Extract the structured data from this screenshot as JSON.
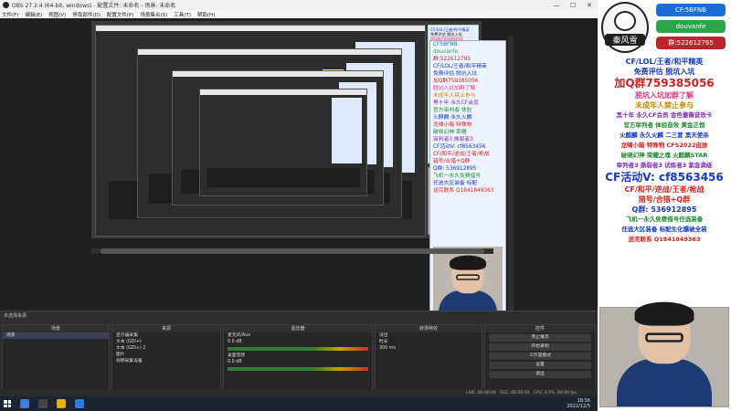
{
  "window": {
    "title": "OBS 27.2.4 (64-bit, windows) - 配置文件: 未命名 - 场景: 未命名",
    "controls": [
      "—",
      "☐",
      "✕"
    ]
  },
  "menu": [
    "文件(F)",
    "编辑(E)",
    "视图(V)",
    "停靠部件(D)",
    "配置文件(P)",
    "场景集合(S)",
    "工具(T)",
    "帮助(H)"
  ],
  "docks": {
    "scenes_header": "场景",
    "scenes": [
      "场景"
    ],
    "sources_header": "来源",
    "sources": [
      "显示器采集",
      "文本 (GDI+)",
      "文本 (GDI+) 2",
      "图片",
      "视频采集设备"
    ],
    "mixer_header": "混音器",
    "mixer": [
      "麦克风/Aux",
      "桌面音频"
    ],
    "mixer_db": [
      "0.0 dB",
      "0.0 dB"
    ],
    "transitions_header": "转场特效",
    "transition_value": "淡出",
    "duration_label": "时长",
    "duration_value": "300 ms",
    "controls_header": "控件",
    "controls": [
      "停止推流",
      "开始录制",
      "工作室模式",
      "设置",
      "退出"
    ],
    "filter_label": "未选择来源"
  },
  "status": {
    "live": "LIVE: 00:00:00",
    "rec": "REC: 00:00:00",
    "cpu": "CPU: 4.0%, 60.00 fps"
  },
  "taskbar": {
    "time": "18:56",
    "date": "2022/12/5"
  },
  "overlay": {
    "logo_text": "秦风雪",
    "pills": [
      "CF:5BFNB",
      "douvanfe",
      "群:522612795"
    ],
    "lines": [
      {
        "t": "CF/LOL/王者/和平精英",
        "c": "blue"
      },
      {
        "t": "免费评估 脱坑入坑",
        "c": "blue"
      },
      {
        "t": "加Q群759385056",
        "c": "red",
        "big": true
      },
      {
        "t": "脱坑入坑加群了解",
        "c": "pink"
      },
      {
        "t": "未成年人禁止参与",
        "c": "gold"
      },
      {
        "t": "黑十年 永久CF会员 金色蔷薇音效卡",
        "c": "purple"
      },
      {
        "t": "官方审判者 体验音效 黄金正恒",
        "c": "green"
      },
      {
        "t": "火麒麟 永久火麟 二三套 黑天使杀",
        "c": "blue"
      },
      {
        "t": "龙啸小箱 特殊物 CFS2022皮肤",
        "c": "red"
      },
      {
        "t": "破晓幻神 荣耀之魂 火麒麟STAR",
        "c": "green"
      },
      {
        "t": "审判者3 撕裂者3 试炼者3 紫金满级",
        "c": "purple"
      },
      {
        "t": "CF活动V: cf8563456",
        "c": "blue",
        "big": true
      },
      {
        "t": "CF/和平/逆战/王者/枪战",
        "c": "red"
      },
      {
        "t": "猎号/合猎+Q群",
        "c": "red"
      },
      {
        "t": "Q群: 536912895",
        "c": "blue"
      },
      {
        "t": "飞机一永久免费借号任选装备",
        "c": "green"
      },
      {
        "t": "任选大区装备 标配生化爆破全装",
        "c": "blue"
      },
      {
        "t": "送完联系 Q1841849363",
        "c": "red"
      }
    ]
  },
  "canvas_poster": [
    "CF/LOL/王者/和平精英",
    "免费评估 脱坑入坑",
    "加Q群759385056",
    "脱坑入坑加群了解",
    "未成年人禁止参与",
    "黑十年 永久CF会员",
    "官方审判者 体验",
    "火麒麟 永久火麟",
    "龙啸小箱 特殊物",
    "破晓幻神 荣耀",
    "审判者3 撕裂者3",
    "CF活动V: cf8563456"
  ],
  "mid_poster": [
    "CF5BFNB",
    "douvanfe",
    "群:522612795",
    "",
    "CF/LOL/王者/和平精英",
    "免费评估 脱坑入坑",
    "加Q群759385056",
    "脱坑入坑加群了解",
    "未成年人禁止参与",
    "黑十年 永久CF会员",
    "官方审判者 体验",
    "火麒麟 永久火麟",
    "龙啸小箱 特殊物",
    "破晓幻神 荣耀",
    "审判者3 撕裂者3",
    "CF活动V: cf8563456",
    "CF/和平/逆战/王者/枪战",
    "猎号/合猎+Q群",
    "Q群: 536912895",
    "飞机一永久免费借号",
    "任选大区装备 标配",
    "送完联系 Q1841849363"
  ],
  "colors": {
    "obs_bg": "#2b2b2b",
    "accent": "#1a6fd6",
    "poster_bg": "#e6edff"
  }
}
